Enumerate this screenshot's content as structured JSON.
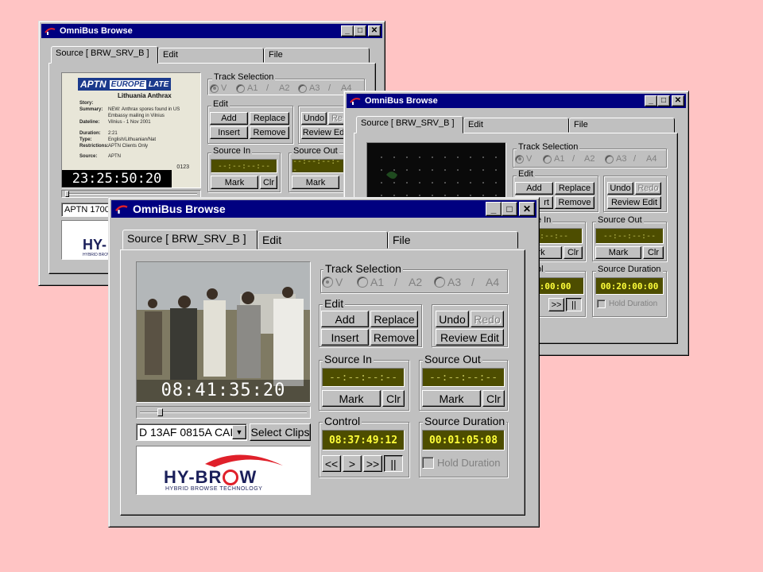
{
  "windows": {
    "back": {
      "title": "OmniBus Browse",
      "tabs": [
        "Source [ BRW_SRV_B ]",
        "Edit",
        "File"
      ],
      "track_selection": {
        "label": "Track Selection",
        "v": "V",
        "a1": "A1",
        "a2": "A2",
        "a3": "A3",
        "a4": "A4",
        "sep": "/"
      },
      "edit": {
        "label": "Edit",
        "add": "Add",
        "replace": "Replace",
        "insert": "Insert",
        "remove": "Remove",
        "undo": "Undo",
        "redo": "Re",
        "review_edit": "Review Ed"
      },
      "source_in": {
        "label": "Source In",
        "value": "--:--:--:--",
        "mark": "Mark",
        "clr": "Clr"
      },
      "source_out": {
        "label": "Source Out",
        "value": "--:--:--:--",
        "mark": "Mark"
      },
      "video": {
        "timecode": "23:25:50:20",
        "overlay_header": "APTN",
        "overlay_header2": "EUROPE",
        "overlay_header3": "LATE",
        "overlay_title": "Lithuania Anthrax",
        "overlay_rows": [
          [
            "Story:",
            ""
          ],
          [
            "Summary:",
            "NEW: Anthrax spores found in US Embassy mailing in Vilnius"
          ],
          [
            "Dateline:",
            "Vilnius - 1 Nov 2001"
          ],
          [
            "Duration:",
            "2:21"
          ],
          [
            "Type:",
            "English/Lithuanian/Nat"
          ],
          [
            "Restrictions:",
            "APTN Clients Only"
          ],
          [
            "Source:",
            "APTN"
          ]
        ],
        "overlay_code": "0123"
      },
      "clip_field": "APTN 1700",
      "logo": {
        "main": "HY-",
        "sub": "HYBRID BROWS"
      }
    },
    "middle": {
      "title": "OmniBus Browse",
      "tabs": [
        "Source [ BRW_SRV_B ]",
        "Edit",
        "File"
      ],
      "track_selection": {
        "label": "Track Selection",
        "v": "V",
        "a1": "A1",
        "a2": "A2",
        "a3": "A3",
        "a4": "A4",
        "sep": "/"
      },
      "edit": {
        "label": "Edit",
        "add": "Add",
        "replace": "Replace",
        "insert": "rt",
        "remove": "Remove",
        "undo": "Undo",
        "redo": "Redo",
        "review_edit": "Review Edit"
      },
      "source_in": {
        "label": "e In",
        "value": "--:--:--",
        "mark": "ark",
        "clr": "Clr"
      },
      "source_out": {
        "label": "Source Out",
        "value": "--:--:--:--",
        "mark": "Mark",
        "clr": "Clr"
      },
      "control": {
        "label": "ol",
        "value": "00:00:00"
      },
      "source_duration": {
        "label": "Source Duration",
        "value": "00:20:00:00",
        "hold": "Hold Duration"
      },
      "transport": {
        "ffwd": ">>",
        "pause": "||"
      }
    },
    "front": {
      "title": "OmniBus Browse",
      "tabs": [
        "Source [ BRW_SRV_B ]",
        "Edit",
        "File"
      ],
      "track_selection": {
        "label": "Track Selection",
        "v": "V",
        "a1": "A1",
        "a2": "A2",
        "a3": "A3",
        "a4": "A4",
        "sep": "/"
      },
      "edit": {
        "label": "Edit",
        "add": "Add",
        "replace": "Replace",
        "insert": "Insert",
        "remove": "Remove",
        "undo": "Undo",
        "redo": "Redo",
        "review_edit": "Review Edit"
      },
      "source_in": {
        "label": "Source In",
        "value": "--:--:--:--",
        "mark": "Mark",
        "clr": "Clr"
      },
      "source_out": {
        "label": "Source Out",
        "value": "--:--:--:--",
        "mark": "Mark",
        "clr": "Clr"
      },
      "control": {
        "label": "Control",
        "value": "08:37:49:12"
      },
      "source_duration": {
        "label": "Source Duration",
        "value": "00:01:05:08",
        "hold": "Hold Duration"
      },
      "transport": {
        "rew": "<<",
        "play": ">",
        "ffwd": ">>",
        "pause": "||"
      },
      "video": {
        "timecode": "08:41:35:20"
      },
      "clip_select": "D 13AF 0815A CAI",
      "select_clips": "Select Clips",
      "logo": {
        "main_a": "HY-BR",
        "main_b": "W",
        "sub": "HYBRID BROWSE TECHNOLOGY"
      }
    }
  },
  "colors": {
    "desktop": "#ffc4c4",
    "titlebar": "#000080",
    "face": "#c0c0c0",
    "lcd_bg": "#4d4d00",
    "lcd_text": "#ffff3a",
    "logo_red": "#e0202a",
    "logo_navy": "#1a1f5a"
  },
  "icons": {
    "title": "omnibus-swoosh-icon",
    "minimize": "minimize-icon",
    "maximize": "maximize-icon",
    "close": "close-icon",
    "dropdown": "chevron-down-icon"
  }
}
